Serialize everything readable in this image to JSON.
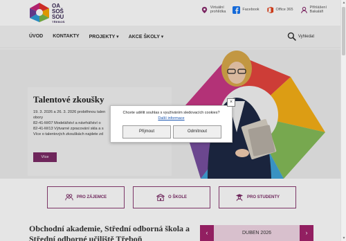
{
  "logo": {
    "line1": "OA",
    "line2": "SOŠ",
    "line3": "SOU",
    "sub": "TŘEBOŇ"
  },
  "toplinks": [
    {
      "label1": "Virtuální",
      "label2": "prohlídka",
      "icon": "map-pin-icon",
      "color": "#8a2b6e"
    },
    {
      "label1": "Facebook",
      "label2": "",
      "icon": "facebook-icon",
      "color": "#1877f2"
    },
    {
      "label1": "Office 365",
      "label2": "",
      "icon": "office-icon",
      "color": "#e2421c"
    },
    {
      "label1": "Přihlášení",
      "label2": "Bakaláři",
      "icon": "login-icon",
      "color": "#8a2b6e"
    }
  ],
  "nav": {
    "items": [
      "ÚVOD",
      "KONTAKTY",
      "PROJEKTY ▾",
      "AKCE ŠKOLY ▾"
    ],
    "search_label": "Vyhledat"
  },
  "hero": {
    "title": "Talentové zkoušky",
    "desc_lines": [
      "19. 3. 2026 a 26. 3. 2026 proběhnou talen",
      "obory",
      "82-41-M/07 Modelářství a návrhářství o",
      "82-41-M/13 Výtvarné zpracování skla a s",
      "Více o talentových zkouškách najdete zd"
    ],
    "button": "Více"
  },
  "tiles": [
    {
      "label": "PRO ZÁJEMCE",
      "icon": "people-icon"
    },
    {
      "label": "O ŠKOLE",
      "icon": "school-building-icon"
    },
    {
      "label": "PRO STUDENTY",
      "icon": "student-icon"
    }
  ],
  "bottom": {
    "school_title": "Obchodní akademie, Střední odborná škola a Střední odborné učiliště Třeboň",
    "calendar": {
      "prev": "‹",
      "month": "DUBEN 2026",
      "next": "›"
    }
  },
  "cookie": {
    "text": "Chcete udělit souhlas s využíváním sledovacích cookies?",
    "link": "Další informace",
    "accept": "Přijmout",
    "reject": "Odmítnout",
    "close": "×"
  },
  "colors": {
    "brand": "#7b2b66",
    "calendar_accent": "#a3236d",
    "calendar_bg": "#f1d6e5"
  }
}
